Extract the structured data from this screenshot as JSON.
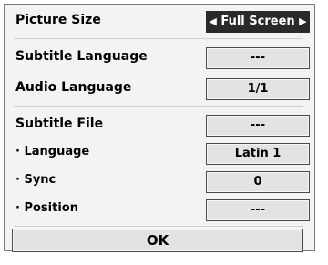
{
  "menu": {
    "picture_size": {
      "label": "Picture Size",
      "value": "Full Screen",
      "left_arrow": "◀",
      "right_arrow": "▶"
    },
    "subtitle_language": {
      "label": "Subtitle Language",
      "value": "---"
    },
    "audio_language": {
      "label": "Audio Language",
      "value": "1/1"
    },
    "subtitle_file": {
      "label": "Subtitle File",
      "value": "---"
    },
    "language": {
      "label": "· Language",
      "value": "Latin 1"
    },
    "sync": {
      "label": "· Sync",
      "value": "0"
    },
    "position": {
      "label": "· Position",
      "value": "---"
    },
    "ok_label": "OK"
  }
}
